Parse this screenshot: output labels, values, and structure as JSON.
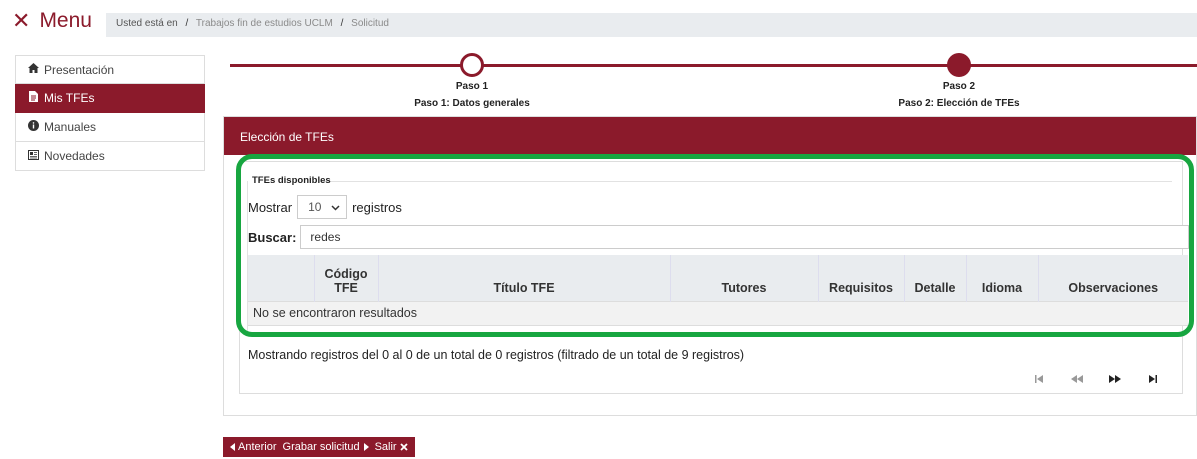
{
  "topbar": {
    "menu_icon": "close-icon",
    "menu_label": "Menu",
    "breadcrumb_prefix": "Usted está en",
    "separator": "/",
    "crumbs": [
      "Trabajos fin de estudios UCLM",
      "Solicitud"
    ]
  },
  "sidebar": {
    "items": [
      {
        "label": "Presentación",
        "icon": "home-icon"
      },
      {
        "label": "Mis TFEs",
        "icon": "document-icon"
      },
      {
        "label": "Manuales",
        "icon": "info-icon"
      },
      {
        "label": "Novedades",
        "icon": "news-icon"
      }
    ],
    "active_index": 1
  },
  "stepper": {
    "steps": [
      {
        "title": "Paso 1",
        "subtitle": "Paso 1: Datos generales",
        "state": "completed"
      },
      {
        "title": "Paso 2",
        "subtitle": "Paso 2: Elección de TFEs",
        "state": "current"
      }
    ]
  },
  "card": {
    "header": "Elección de TFEs",
    "legend": "TFEs disponibles",
    "show_prefix": "Mostrar",
    "show_value": "10",
    "show_suffix": "registros",
    "search_label": "Buscar:",
    "search_value": "redes",
    "table": {
      "columns": [
        "",
        "Código TFE",
        "Título TFE",
        "Tutores",
        "Requisitos",
        "Detalle",
        "Idioma",
        "Observaciones"
      ],
      "empty_message": "No se encontraron resultados"
    },
    "info": "Mostrando registros del 0 al 0 de un total de 0 registros (filtrado de un total de 9 registros)",
    "pager": {
      "first": "⏮",
      "prev": "◀◀",
      "next": "▶▶",
      "last": "⏭"
    }
  },
  "footer": {
    "prev_label": "Anterior",
    "save_label": "Grabar solicitud",
    "exit_label": "Salir"
  },
  "colors": {
    "brand": "#8b1a2b",
    "highlight": "#17a640"
  }
}
